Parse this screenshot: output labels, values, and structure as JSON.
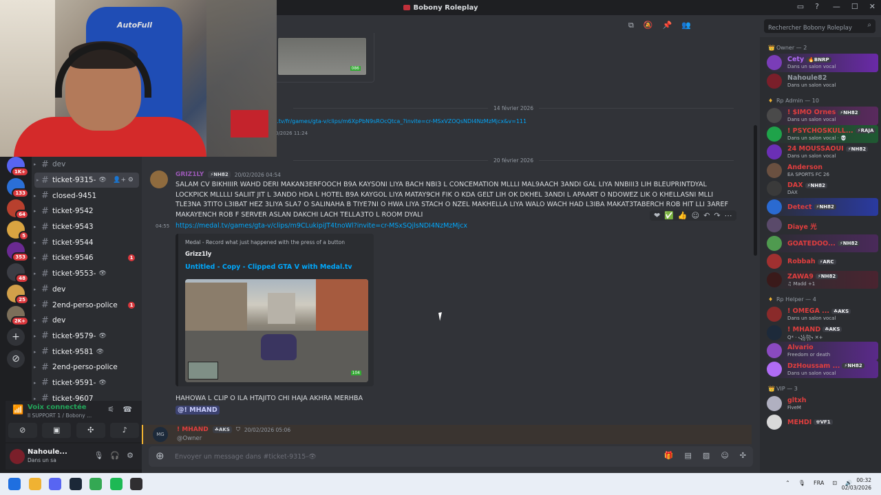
{
  "window": {
    "title": "Bobony Roleplay",
    "controls": [
      "—",
      "☐",
      "✕"
    ],
    "top_icons": [
      "inbox-icon",
      "help-icon"
    ]
  },
  "webcam": {
    "chair_brand": "AutoFull"
  },
  "server_rail": {
    "servers": [
      {
        "color": "#5865f2",
        "badge": "1K+"
      },
      {
        "color": "#2b6fd6",
        "badge": "133"
      },
      {
        "color": "#b8402e",
        "badge": "64"
      },
      {
        "color": "#d9a441",
        "badge": "5"
      },
      {
        "color": "#6a2a91",
        "badge": "353"
      },
      {
        "color": "#3b3d44",
        "badge": "48"
      },
      {
        "color": "#d2a04a",
        "badge": "25"
      },
      {
        "color": "#7c6f5a",
        "badge": "2K+"
      }
    ],
    "add_label": "+",
    "explore_label": "⊘"
  },
  "channels": [
    {
      "name": "dev",
      "state": "normal",
      "unread": "",
      "eye": ""
    },
    {
      "name": "ticket-9315-",
      "state": "active",
      "unread": "",
      "eye": "👁"
    },
    {
      "name": "closed-9451",
      "state": "bright",
      "unread": "",
      "eye": ""
    },
    {
      "name": "ticket-9542",
      "state": "bright",
      "unread": "",
      "eye": ""
    },
    {
      "name": "ticket-9543",
      "state": "bright",
      "unread": "",
      "eye": ""
    },
    {
      "name": "ticket-9544",
      "state": "bright",
      "unread": "",
      "eye": ""
    },
    {
      "name": "ticket-9546",
      "state": "bright",
      "unread": "1",
      "eye": ""
    },
    {
      "name": "ticket-9553-",
      "state": "bright",
      "unread": "",
      "eye": "👁"
    },
    {
      "name": "dev",
      "state": "bright",
      "unread": "",
      "eye": ""
    },
    {
      "name": "2end-perso-police",
      "state": "bright",
      "unread": "1",
      "eye": ""
    },
    {
      "name": "dev",
      "state": "bright",
      "unread": "",
      "eye": ""
    },
    {
      "name": "ticket-9579-",
      "state": "bright",
      "unread": "",
      "eye": "👁"
    },
    {
      "name": "ticket-9581",
      "state": "bright",
      "unread": "",
      "eye": "👁"
    },
    {
      "name": "2end-perso-police",
      "state": "bright",
      "unread": "",
      "eye": ""
    },
    {
      "name": "ticket-9591-",
      "state": "bright",
      "unread": "",
      "eye": "👁"
    },
    {
      "name": "ticket-9607",
      "state": "bright",
      "unread": "",
      "eye": ""
    }
  ],
  "voice": {
    "connected_label": "Voix connectée",
    "channel": "ll SUPPORT 1 / Bobony ..."
  },
  "user": {
    "name": "Nahoule...",
    "status": "Dans un sa"
  },
  "chat": {
    "prev_link": "l.tv/fr/games/gta-v/clips/m6XpPbN9sROcQtca_?invite=cr-MSxVZOQsNDI4NzMzMjcx&v=111",
    "prev_time": "0/2026 11:24",
    "prev_thumb_label": "086",
    "date1": "14 février 2026",
    "date2": "20 février 2026",
    "message": {
      "author": "GRIZ1LY",
      "tag": "⚡NH82",
      "timestamp": "20/02/2026 04:54",
      "text": "SALAM CV BIKHIIIR  WAHD DERI MAKAN3ERFOOCH B9A KAYSONI LIYA BACH NBI3 L CONCEMATION MLLLI MAL9AACH 3ANDI GAL LIYA NNBIII3 LIH BLEUPRINTDYAL LOCKPICK MLLLLI SALIIT JIT L 3ANDO HDA L HOTEL B9A KAYGOL LIYA MATAY9CH FIK O KDA GELT LIH OK DKHEL 3ANDI L APAART O NDOWEZ LIK O KHELLASNI MLLI TLE3NA 3TITO L3IBAT HEZ 3LIYA SLA7 O SALINAHA B TIYE7NI O HWA LIYA STACH O NZEL MAKHELLA LIYA WALO WACH HAD L3IBA MAKAT3TABERCH ROB HIT LLI 3AREF MAKAYENCH ROB F SERVER ASLAN DAKCHI LACH TELLA3TO L ROOM DYALI",
      "line_time": "04:55",
      "link": "https://medal.tv/games/gta-v/clips/m9CLukipiJT4tnoWl?invite=cr-MSxSQjlsNDI4NzMzMjcx",
      "reactions": [
        "❤",
        "✅",
        "👍",
        "☺",
        "↶",
        "↷",
        "⋯"
      ]
    },
    "embed": {
      "provider": "Medal - Record what just happened with the press of a button",
      "author": "Grizz1ly",
      "title": "Untitled - Copy - Clipped GTA V with Medal.tv",
      "speed_label": "104"
    },
    "message2": "HAHOWA L CLIP O ILA HTAJITO CHI HAJA AKHRA MERHBA",
    "mention": "@! MHAND",
    "reply": {
      "author": "! MHAND",
      "tag": "☘AKS",
      "timestamp": "20/02/2026 05:06",
      "subtext": "@Owner",
      "avatar_text": "MG"
    },
    "composer_placeholder": "Envoyer un message dans #ticket-9315-👁",
    "header_icons": [
      "threads-icon",
      "mute-icon",
      "pin-icon",
      "members-icon"
    ],
    "composer_icons": [
      "gift-icon",
      "gif-icon",
      "sticker-icon",
      "emoji-icon",
      "apps-icon"
    ]
  },
  "members": {
    "search_placeholder": "Rechercher Bobony Roleplay",
    "groups": [
      {
        "title": "Owner — 2",
        "icon": "👑",
        "members": [
          {
            "name": "Cety",
            "tag": "🔥BNRP",
            "sub": "Dans un salon vocal",
            "color": "#b06cf5",
            "avatar": "#7a3db8",
            "highlight": "linear-gradient(90deg,#2b2d31,#6a2aa8)"
          },
          {
            "name": "Nahoule82",
            "tag": "",
            "sub": "Dans un salon vocal",
            "color": "#949ba4",
            "avatar": "#7a1f2a",
            "highlight": ""
          }
        ]
      },
      {
        "title": "Rp Admin — 10",
        "icon": "♦",
        "members": [
          {
            "name": "! $IMO Ornes",
            "tag": "⚡NH82",
            "sub": "Dans un salon vocal",
            "color": "#e03e3e",
            "avatar": "#4a4a4a",
            "highlight": "linear-gradient(90deg,#2b2d31,#5a2a5e)"
          },
          {
            "name": "! PSYCHOSKULL...",
            "tag": "⚡RAJA",
            "sub": "Dans un salon vocal · 💀",
            "color": "#e03e3e",
            "avatar": "#1fa34a",
            "highlight": "linear-gradient(90deg,#2b2d31,#1f5a32)"
          },
          {
            "name": "24 MOUSSAOUI",
            "tag": "⚡NH82",
            "sub": "Dans un salon vocal",
            "color": "#e03e3e",
            "avatar": "#6b2fb5",
            "highlight": ""
          },
          {
            "name": "Anderson",
            "tag": "",
            "sub": "EA SPORTS FC 26",
            "color": "#e03e3e",
            "avatar": "#6a5040",
            "highlight": ""
          },
          {
            "name": "DAX",
            "tag": "⚡NH82",
            "sub": "DAX",
            "color": "#e03e3e",
            "avatar": "#3a3a3a",
            "highlight": ""
          },
          {
            "name": "Detect",
            "tag": "⚡NH82",
            "sub": "",
            "color": "#e03e3e",
            "avatar": "#2a6ad1",
            "highlight": "linear-gradient(90deg,#2b2d31,#2a3aa0)"
          },
          {
            "name": "Diaye 光",
            "tag": "",
            "sub": "",
            "color": "#e03e3e",
            "avatar": "#5a4a6a",
            "highlight": ""
          },
          {
            "name": "GOATEDOO...",
            "tag": "⚡NH82",
            "sub": "",
            "color": "#e03e3e",
            "avatar": "#4f9a4f",
            "highlight": "linear-gradient(90deg,#2b2d31,#4a2a5a)"
          },
          {
            "name": "Robbah",
            "tag": "⚡ARC",
            "sub": "",
            "color": "#e03e3e",
            "avatar": "#a03030",
            "highlight": ""
          },
          {
            "name": "ZAWA9",
            "tag": "⚡NH82",
            "sub": "♫ Madd +1",
            "color": "#e03e3e",
            "avatar": "#3a1a1a",
            "highlight": "linear-gradient(90deg,#2b2d31,#4a2430)"
          }
        ]
      },
      {
        "title": "Rp Helper — 4",
        "icon": "♦",
        "members": [
          {
            "name": "! OMEGA ...",
            "tag": "☘AKS",
            "sub": "Dans un salon vocal",
            "color": "#e03e3e",
            "avatar": "#8a2a2a",
            "highlight": ""
          },
          {
            "name": "! MHAND",
            "tag": "☘AKS",
            "sub": "Q* · ꧁꧂ ✕+",
            "color": "#e03e3e",
            "avatar": "#1d2a3a",
            "highlight": ""
          },
          {
            "name": "Alvario",
            "tag": "",
            "sub": "Freedom or death",
            "color": "#e03e3e",
            "avatar": "#8a4ac0",
            "highlight": "linear-gradient(90deg,#2b2d31,#5a2a8a)"
          },
          {
            "name": "DzHoussam ...",
            "tag": "⚡NH82",
            "sub": "Dans un salon vocal",
            "color": "#e03e3e",
            "avatar": "#b06cf5",
            "highlight": "linear-gradient(90deg,#2b2d31,#5a2a8a)"
          }
        ]
      },
      {
        "title": "VIP — 3",
        "icon": "👑",
        "members": [
          {
            "name": "gltxh",
            "tag": "",
            "sub": "FiveM",
            "color": "#e03e3e",
            "avatar": "#b0b0c0",
            "highlight": ""
          },
          {
            "name": "MEHDI",
            "tag": "☢VF1",
            "sub": "",
            "color": "#e03e3e",
            "avatar": "#d9d9d9",
            "highlight": ""
          }
        ]
      }
    ]
  },
  "taskbar": {
    "apps": [
      {
        "name": "windows-icon",
        "color": "#1f6fe0"
      },
      {
        "name": "files-icon",
        "color": "#f0b232"
      },
      {
        "name": "discord-icon",
        "color": "#5865f2"
      },
      {
        "name": "steam-icon",
        "color": "#1b2838"
      },
      {
        "name": "chrome-icon",
        "color": "#34a853"
      },
      {
        "name": "spotify-icon",
        "color": "#1db954"
      },
      {
        "name": "obs-icon",
        "color": "#302e31"
      }
    ],
    "language": "FRA",
    "time": "00:32",
    "date": "02/03/2026"
  }
}
